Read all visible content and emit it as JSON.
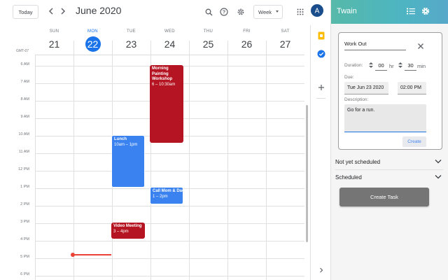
{
  "calendar": {
    "today_label": "Today",
    "month_title": "June 2020",
    "view_select": "Week",
    "avatar_letter": "A",
    "timezone": "GMT-07",
    "days": [
      {
        "name": "SUN",
        "num": "21",
        "today": false
      },
      {
        "name": "MON",
        "num": "22",
        "today": true
      },
      {
        "name": "TUE",
        "num": "23",
        "today": false
      },
      {
        "name": "WED",
        "num": "24",
        "today": false
      },
      {
        "name": "THU",
        "num": "25",
        "today": false
      },
      {
        "name": "FRI",
        "num": "26",
        "today": false
      },
      {
        "name": "SAT",
        "num": "27",
        "today": false
      }
    ],
    "hours": [
      "6 AM",
      "7 AM",
      "8 AM",
      "9 AM",
      "10 AM",
      "11 AM",
      "12 PM",
      "1 PM",
      "2 PM",
      "3 PM",
      "4 PM",
      "5 PM",
      "6 PM"
    ],
    "events": [
      {
        "title": "Morning Painting Workshop",
        "time": "6 – 10:30am",
        "day": "WED",
        "color": "#b51522"
      },
      {
        "title": "Lunch",
        "time": "10am – 1pm",
        "day": "TUE",
        "color": "#3a82f0"
      },
      {
        "title": "Call Mom & Dad",
        "time": "1 – 2pm",
        "day": "WED",
        "color": "#3a82f0"
      },
      {
        "title": "Video Meeting",
        "time": "3 – 4pm",
        "day": "TUE",
        "color": "#b51522"
      }
    ],
    "icons": [
      "search-icon",
      "help-icon",
      "settings-icon",
      "apps-grid-icon"
    ]
  },
  "side_strip": {
    "icons": [
      "keep-icon",
      "tasks-icon",
      "add-icon",
      "expand-panel-icon"
    ]
  },
  "twain": {
    "title": "Twain",
    "header_icons": [
      "list-icon",
      "settings-icon"
    ],
    "task": {
      "name": "Work Out",
      "duration_label": "Duration:",
      "hours": "00",
      "hours_unit": "hr",
      "minutes": "30",
      "minutes_unit": "min",
      "due_label": "Due:",
      "due_date": "Tue Jun 23 2020",
      "due_time": "02:00 PM",
      "description_label": "Description:",
      "description": "Go for a run.",
      "create_label": "Create"
    },
    "sections": [
      {
        "label": "Not yet scheduled"
      },
      {
        "label": "Scheduled"
      }
    ],
    "create_task_label": "Create Task",
    "accent": "#4db5c2"
  }
}
